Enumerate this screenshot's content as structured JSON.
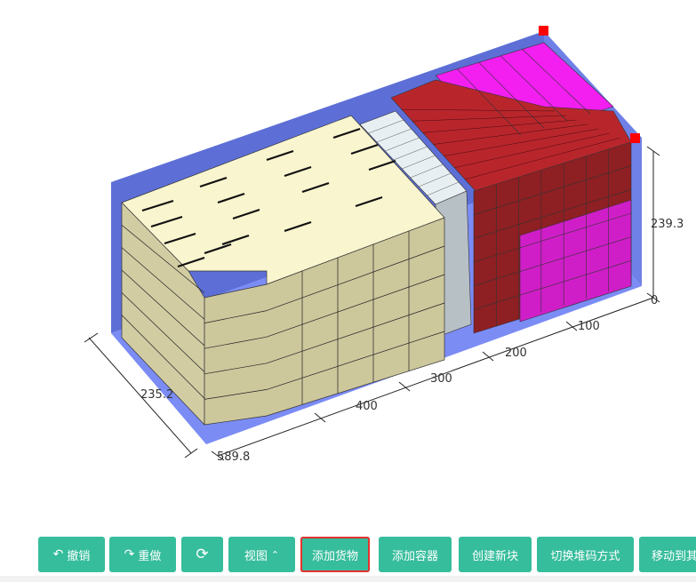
{
  "viewport": {
    "dimensions": {
      "length": "589.8",
      "width": "235.2",
      "height": "239.3",
      "height_zero": "0",
      "ticks": [
        "100",
        "200",
        "300",
        "400"
      ]
    }
  },
  "toolbar": {
    "undo_label": "撤销",
    "redo_label": "重做",
    "view_label": "视图",
    "add_goods_label": "添加货物",
    "add_container_label": "添加容器",
    "create_block_label": "创建新块",
    "switch_stacking_label": "切换堆码方式",
    "move_label": "移动到其"
  },
  "colors": {
    "accent": "#36bd9c",
    "container_wall": "#5d6fd6",
    "container_floor": "#7b8cf5",
    "cargo_cream": "#f7f3c9",
    "cargo_red": "#9c2428",
    "cargo_magenta": "#e31ee0",
    "cargo_lightblue": "#e6eef2",
    "selection_border": "#e6322f"
  }
}
